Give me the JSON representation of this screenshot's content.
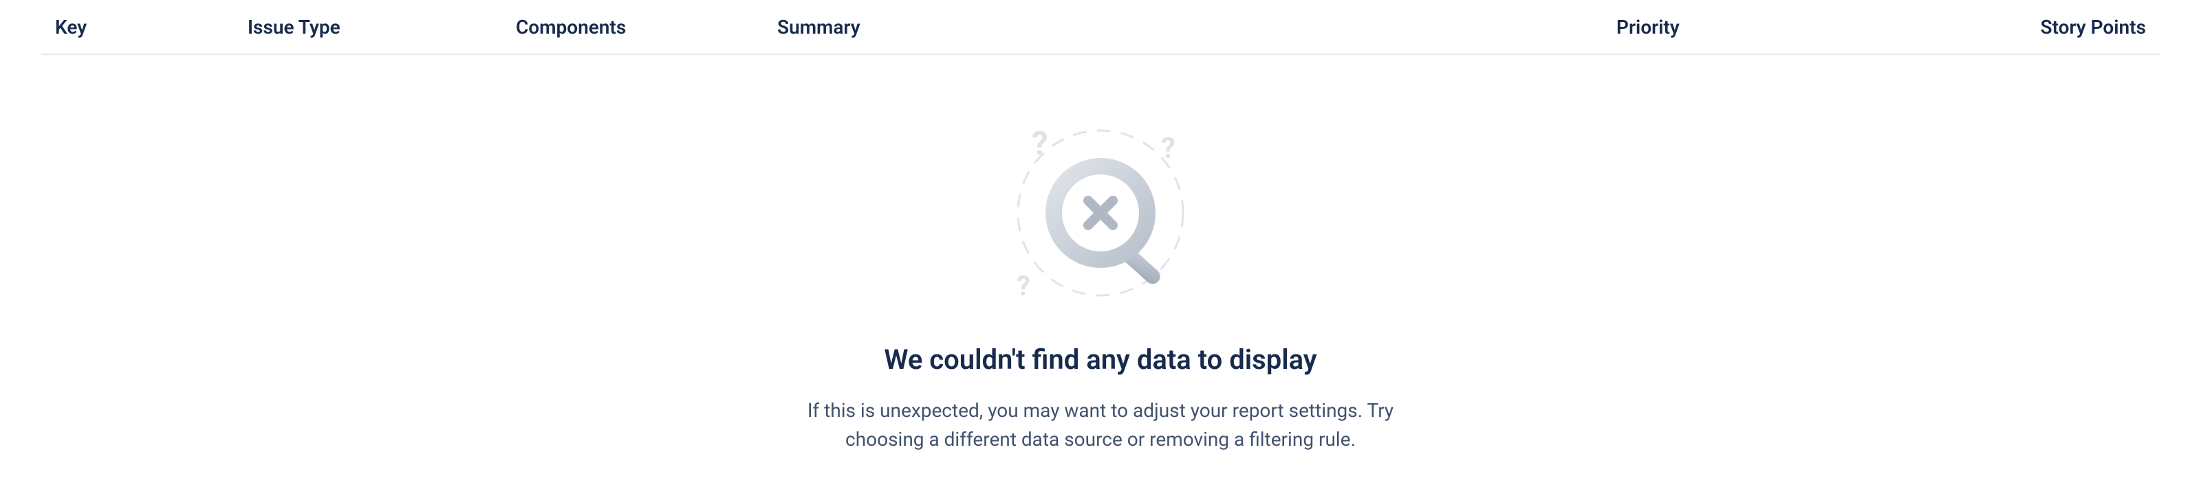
{
  "table": {
    "headers": {
      "key": "Key",
      "issue_type": "Issue Type",
      "components": "Components",
      "summary": "Summary",
      "priority": "Priority",
      "story_points": "Story Points"
    }
  },
  "empty_state": {
    "heading": "We couldn't find any data to display",
    "description": "If this is unexpected, you may want to adjust your report settings. Try choosing a different data source or removing a filtering rule."
  }
}
